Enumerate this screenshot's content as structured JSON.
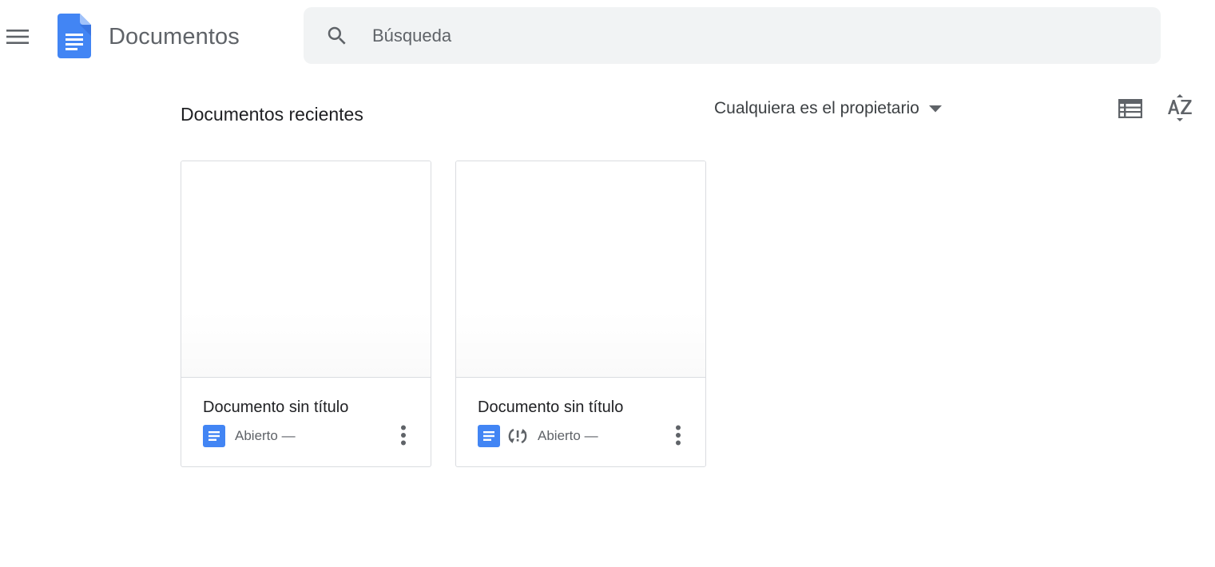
{
  "header": {
    "menu_icon": "hamburger-menu-icon",
    "logo_icon": "google-docs-logo-icon",
    "app_title": "Documentos",
    "search": {
      "icon": "search-icon",
      "placeholder": "Búsqueda",
      "value": ""
    }
  },
  "toolbar": {
    "section_title": "Documentos recientes",
    "owner_filter": {
      "label": "Cualquiera es el propietario",
      "icon": "caret-down-icon"
    },
    "view_toggle_icon": "list-view-icon",
    "sort_icon": "sort-az-icon"
  },
  "documents": [
    {
      "title": "Documento sin título",
      "opened_label": "Abierto —",
      "type_icon": "docs-file-icon",
      "offline_status": false,
      "more_icon": "more-vert-icon"
    },
    {
      "title": "Documento sin título",
      "opened_label": "Abierto —",
      "type_icon": "docs-file-icon",
      "offline_status": true,
      "status_icon": "sync-problem-icon",
      "more_icon": "more-vert-icon"
    }
  ],
  "colors": {
    "docs_blue": "#4285f4",
    "docs_blue_dark": "#1a73e8",
    "icon_gray": "#5f6368",
    "search_bg": "#f1f3f4",
    "card_border": "#dadce0",
    "text_primary": "#202124",
    "text_secondary": "#5f6368"
  }
}
